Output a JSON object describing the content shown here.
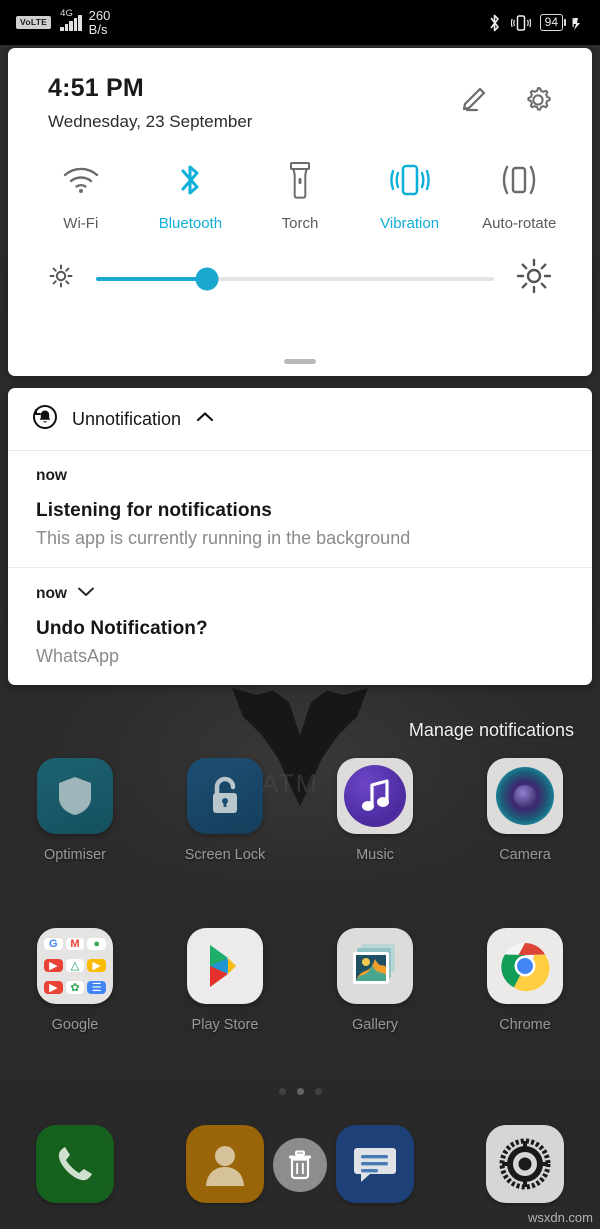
{
  "status_bar": {
    "volte_label": "VoLTE",
    "network_type": "4G",
    "net_speed_value": "260",
    "net_speed_unit": "B/s",
    "bluetooth_icon": "bluetooth-icon",
    "vibrate_icon": "vibration-icon",
    "battery_level": "94",
    "charging_icon": "charging-bolt-icon"
  },
  "quick_settings": {
    "time": "4:51 PM",
    "date": "Wednesday, 23 September",
    "edit_icon": "pencil-edit-icon",
    "settings_icon": "gear-icon",
    "accent_color": "#0fb0d8",
    "inactive_color": "#5a5a5a",
    "toggles": [
      {
        "label": "Wi-Fi",
        "icon": "wifi-icon",
        "state": "off"
      },
      {
        "label": "Bluetooth",
        "icon": "bluetooth-icon",
        "state": "on"
      },
      {
        "label": "Torch",
        "icon": "torch-icon",
        "state": "off"
      },
      {
        "label": "Vibration",
        "icon": "vibration-icon",
        "state": "on"
      },
      {
        "label": "Auto-rotate",
        "icon": "auto-rotate-icon",
        "state": "off"
      }
    ],
    "brightness": {
      "low_icon": "brightness-low-icon",
      "high_icon": "brightness-high-icon",
      "value_percent": 28
    },
    "drag_handle": "panel-drag-handle"
  },
  "notifications": {
    "group_app_name": "Unnotification",
    "group_app_icon": "undo-bell-icon",
    "collapse_icon": "chevron-up-icon",
    "items": [
      {
        "time": "now",
        "title": "Listening for notifications",
        "body": "This app is currently running in the background",
        "expand_icon": ""
      },
      {
        "time": "now",
        "title": "Undo Notification?",
        "body": "WhatsApp",
        "expand_icon": "chevron-down-icon"
      }
    ],
    "manage_label": "Manage notifications"
  },
  "home_screen": {
    "wallpaper_text": "BATM",
    "rows": [
      [
        {
          "label": "Optimiser",
          "icon": "shield-icon"
        },
        {
          "label": "Screen Lock",
          "icon": "lock-icon"
        },
        {
          "label": "Music",
          "icon": "music-note-icon"
        },
        {
          "label": "Camera",
          "icon": "camera-lens-icon"
        }
      ],
      [
        {
          "label": "Google",
          "icon": "google-folder-icon"
        },
        {
          "label": "Play Store",
          "icon": "play-store-icon"
        },
        {
          "label": "Gallery",
          "icon": "gallery-icon"
        },
        {
          "label": "Chrome",
          "icon": "chrome-icon"
        }
      ]
    ],
    "google_folder_apps": [
      "G",
      "M",
      "◉",
      "▶",
      "△",
      "▶",
      "▶",
      "✿",
      "☰"
    ],
    "dock": [
      {
        "label": "",
        "icon": "phone-icon"
      },
      {
        "label": "",
        "icon": "contacts-icon"
      },
      {
        "label": "",
        "icon": "messages-icon"
      },
      {
        "label": "",
        "icon": "settings-gear-icon"
      }
    ],
    "page_dots": {
      "count": 3,
      "active_index": 1
    },
    "trash_target_icon": "trash-icon"
  },
  "watermark": "wsxdn.com"
}
